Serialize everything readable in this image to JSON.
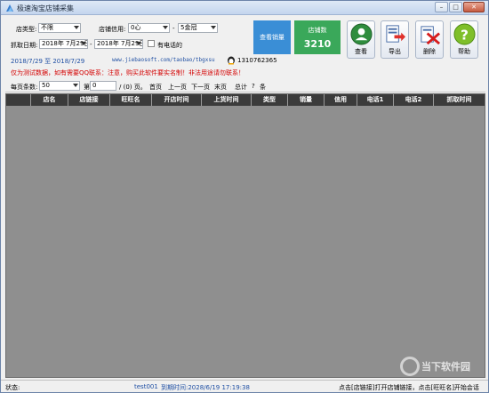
{
  "window": {
    "title": "极速淘宝店铺采集",
    "min_label": "–",
    "max_label": "□",
    "close_label": "✕"
  },
  "filters": {
    "shop_type_label": "店类型:",
    "shop_type_value": "不限",
    "credit_label": "店铺信用:",
    "credit_from": "0心",
    "credit_sep": "-",
    "credit_to": "5金冠",
    "date_label": "抓取日期:",
    "date_from": "2018年 7月29日",
    "date_sep": "-",
    "date_to": "2018年 7月29日",
    "phone_checkbox_label": "有电话的"
  },
  "tiles": {
    "view_count_label": "查看销量",
    "shop_count_label": "店铺数",
    "shop_count_value": "3210"
  },
  "toolbar": {
    "view_label": "查看",
    "export_label": "导出",
    "delete_label": "删除",
    "help_label": "帮助"
  },
  "info": {
    "date_range": "2018/7/29 至 2018/7/29",
    "url": "www.jiebaosoft.com/taobao/tbgxsu",
    "qq": "1310762365",
    "notice": "仅为测试数据，如有需要QQ联系：注意，购买此软件要实名制！非法用途请勿联系！"
  },
  "pager": {
    "per_page_label": "每页条数:",
    "per_page_value": "50",
    "page_label": "第",
    "page_value": "0",
    "page_total": "/ (0) 页。",
    "first": "首页",
    "prev": "上一页",
    "next": "下一页",
    "last": "末页",
    "total_label": "总计",
    "total_value": "?",
    "total_unit": "条"
  },
  "table": {
    "columns": [
      "店名",
      "店链接",
      "旺旺名",
      "开店时间",
      "上货时间",
      "类型",
      "销量",
      "信用",
      "电话1",
      "电话2",
      "抓取时间"
    ]
  },
  "watermark": {
    "text": "当下软件园"
  },
  "status": {
    "label": "状态:",
    "user": "test001",
    "expire": "到期时间:2028/6/19 17:19:38",
    "hint": "点击[店链接]打开店铺链接，点击[旺旺名]开始会话"
  },
  "colors": {
    "title_gradient": "#c3d5ee",
    "tile_blue": "#3a8ed6",
    "tile_green": "#3aa85a",
    "grid_header": "#3b3b3b",
    "grid_body": "#8f8f8f",
    "notice_red": "#d40000"
  }
}
